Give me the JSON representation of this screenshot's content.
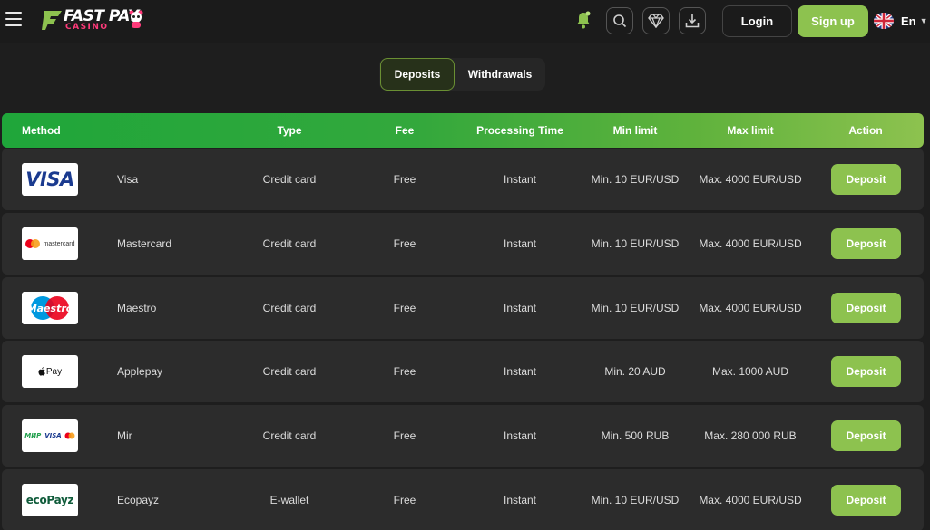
{
  "header": {
    "logo_top": "FAST PAY",
    "logo_bottom": "CASINO",
    "login_label": "Login",
    "signup_label": "Sign up",
    "language": "En",
    "icons": [
      "menu-icon",
      "bell-icon",
      "search-icon",
      "diamond-icon",
      "download-icon",
      "uk-flag-icon",
      "chevron-down-icon"
    ]
  },
  "tabs": [
    {
      "label": "Deposits",
      "active": true
    },
    {
      "label": "Withdrawals",
      "active": false
    }
  ],
  "table": {
    "headers": {
      "method": "Method",
      "type": "Type",
      "fee": "Fee",
      "processing": "Processing Time",
      "min": "Min limit",
      "max": "Max limit",
      "action": "Action"
    },
    "rows": [
      {
        "logo": "VISA",
        "name": "Visa",
        "type": "Credit card",
        "fee": "Free",
        "time": "Instant",
        "min": "Min. 10 EUR/USD",
        "max": "Max. 4000 EUR/USD",
        "action": "Deposit"
      },
      {
        "logo": "mastercard",
        "name": "Mastercard",
        "type": "Credit card",
        "fee": "Free",
        "time": "Instant",
        "min": "Min. 10 EUR/USD",
        "max": "Max. 4000 EUR/USD",
        "action": "Deposit"
      },
      {
        "logo": "Maestro",
        "name": "Maestro",
        "type": "Credit card",
        "fee": "Free",
        "time": "Instant",
        "min": "Min. 10 EUR/USD",
        "max": "Max. 4000 EUR/USD",
        "action": "Deposit"
      },
      {
        "logo": "Pay",
        "name": "Applepay",
        "type": "Credit card",
        "fee": "Free",
        "time": "Instant",
        "min": "Min. 20 AUD",
        "max": "Max. 1000 AUD",
        "action": "Deposit"
      },
      {
        "logo": "МИР",
        "logo2": "VISA",
        "name": "Mir",
        "type": "Credit card",
        "fee": "Free",
        "time": "Instant",
        "min": "Min. 500 RUB",
        "max": "Max. 280 000 RUB",
        "action": "Deposit"
      },
      {
        "logo": "ecoPayz",
        "name": "Ecopayz",
        "type": "E-wallet",
        "fee": "Free",
        "time": "Instant",
        "min": "Min. 10 EUR/USD",
        "max": "Max. 4000 EUR/USD",
        "action": "Deposit"
      }
    ]
  },
  "colors": {
    "accent": "#8dc24f",
    "header_gradient_start": "#1fa63a",
    "background": "#1e1e1e",
    "row_background": "#2c2c2c"
  }
}
